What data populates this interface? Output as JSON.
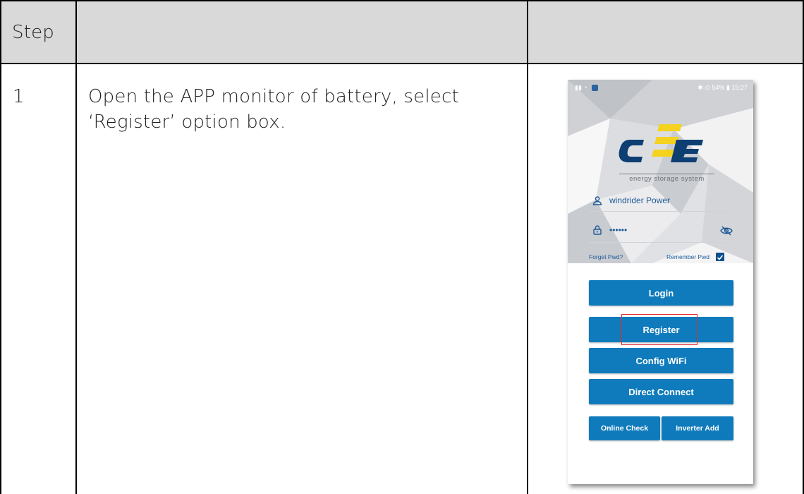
{
  "table": {
    "header": {
      "col1": "Step",
      "col2": "",
      "col3": ""
    },
    "rows": [
      {
        "step": "1",
        "instruction": "Open the APP monitor of battery, select ‘Register’ option box."
      }
    ]
  },
  "app": {
    "status_bar": {
      "right": "✱ ⊙ 54% ▮ 15:27"
    },
    "logo_text": "CEE",
    "logo_caption": "energy storage system",
    "username": "windrider Power",
    "password_mask": "••••••",
    "forget_label": "Forget Pwd?",
    "remember_label": "Remember Pwd",
    "remember_checked": true,
    "buttons": {
      "login": "Login",
      "register": "Register",
      "config_wifi": "Config WiFi",
      "direct_connect": "Direct Connect",
      "online_check": "Online Check",
      "inverter_add": "Inverter Add"
    },
    "colors": {
      "button": "#0f7bbd",
      "logo_blue": "#0e3f73",
      "logo_yellow": "#f4d21e",
      "highlight": "#e22a2a"
    }
  }
}
